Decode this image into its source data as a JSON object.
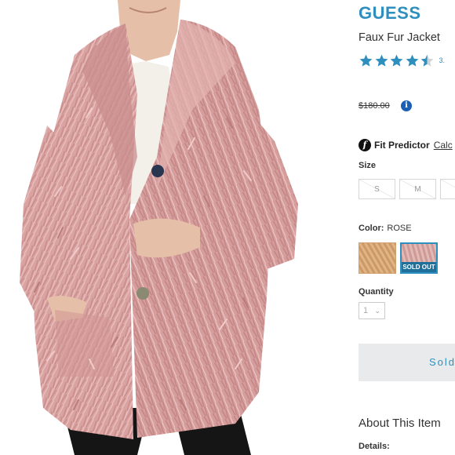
{
  "product": {
    "brand": "GUESS",
    "name": "Faux Fur Jacket",
    "rating_value": 4.5,
    "rating_text": "3.",
    "price": "$180.00",
    "fit_predictor_label": "Fit Predictor",
    "fit_predictor_link": "Calc",
    "size_label": "Size",
    "sizes": [
      "S",
      "M",
      ""
    ],
    "color_label": "Color:",
    "color_value": "ROSE",
    "swatches": [
      {
        "name": "tan",
        "color": "#d9a46b"
      },
      {
        "name": "rose",
        "color": "#d7a3a0",
        "badge": "SOLD OUT"
      }
    ],
    "quantity_label": "Quantity",
    "quantity_value": "1",
    "sold_out_button": "Sold",
    "about_heading": "About This Item",
    "details_label": "Details:"
  },
  "colors": {
    "accent": "#2e8fbf",
    "coat": "#d9a3a2",
    "badge": "#1e6f9a"
  },
  "icons": {
    "info": "info-icon",
    "fit": "fit-predictor-icon",
    "star": "star-icon"
  }
}
